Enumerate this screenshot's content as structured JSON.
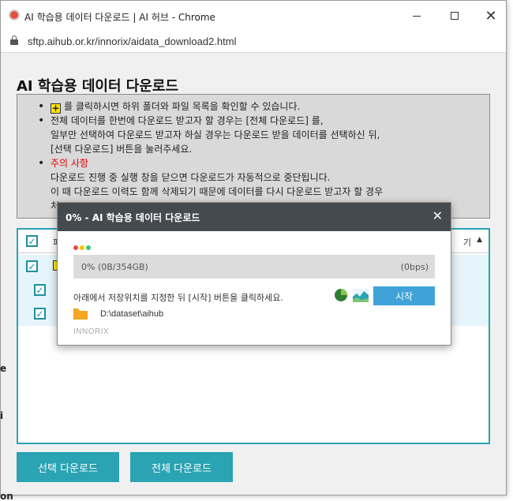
{
  "window": {
    "title": "AI 학습용 데이터 다운로드 | AI 허브 - Chrome",
    "min_glyph": "—",
    "max_glyph": "☐",
    "close_glyph": "✕"
  },
  "address": {
    "url": "sftp.aihub.or.kr/innorix/aidata_download2.html"
  },
  "page": {
    "title": "AI 학습용 데이터 다운로드",
    "notice": {
      "item1_text": "를 클릭하시면 하위 폴더와 파일 목록을 확인할 수 있습니다.",
      "item1_icon": "+",
      "item2_line1": "전체 데이터를 한번에 다운로드 받고자 할 경우는 [전체 다운로드] 를,",
      "item2_line2": "일부만 선택하여 다운로드 받고자 하실 경우는 다운로드 받을 데이터를 선택하신 뒤,",
      "item2_line3": "[선택 다운로드] 버튼을 눌러주세요.",
      "item3_heading": "주의 사항",
      "item3_line1": "다운로드 진행 중 실행 창을 닫으면 다운로드가 자동적으로 중단됩니다.",
      "item3_line2": "이 때 다운로드 이력도 함께 삭제되기 때문에 데이터를 다시 다운로드 받고자 할 경우",
      "item3_line3": "처"
    },
    "list": {
      "header_label": "파",
      "sort_label": "기",
      "sort_icon": "▲",
      "check": "✓"
    },
    "buttons": {
      "select_download": "선택 다운로드",
      "all_download": "전체 다운로드"
    },
    "edge_text": [
      "e",
      "i",
      "on"
    ]
  },
  "dialog": {
    "title": "0% - AI 학습용 데이터 다운로드",
    "close": "✕",
    "dot_colors": [
      "#e74c3c",
      "#f1c40f",
      "#2ecc71"
    ],
    "progress_fraction": 0,
    "progress_text": "0% (0B/354GB)",
    "speed_text": "(0bps)",
    "instruction": "아래에서 저장위치를 지정한 뒤 [시작] 버튼을 클릭하세요.",
    "start_label": "시작",
    "path": "D:\\dataset\\aihub",
    "brand": "INNORIX",
    "accent": "#2aa3b3",
    "start_color": "#3fa3d9"
  }
}
